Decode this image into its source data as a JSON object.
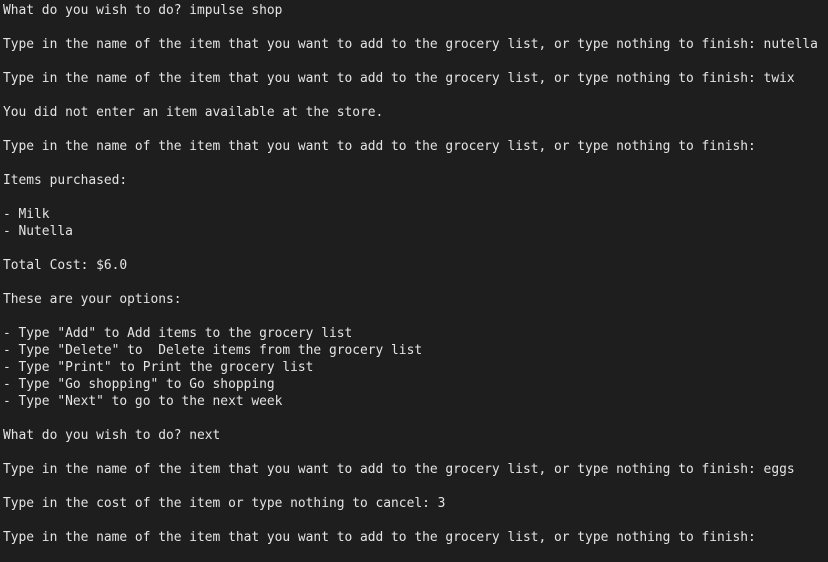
{
  "terminal": {
    "lines": [
      "What do you wish to do? impulse shop",
      "",
      "Type in the name of the item that you want to add to the grocery list, or type nothing to finish: nutella",
      "",
      "Type in the name of the item that you want to add to the grocery list, or type nothing to finish: twix",
      "",
      "You did not enter an item available at the store.",
      "",
      "Type in the name of the item that you want to add to the grocery list, or type nothing to finish:",
      "",
      "Items purchased:",
      "",
      "- Milk",
      "- Nutella",
      "",
      "Total Cost: $6.0",
      "",
      "These are your options:",
      "",
      "- Type \"Add\" to Add items to the grocery list",
      "- Type \"Delete\" to  Delete items from the grocery list",
      "- Type \"Print\" to Print the grocery list",
      "- Type \"Go shopping\" to Go shopping",
      "- Type \"Next\" to go to the next week",
      "",
      "What do you wish to do? next",
      "",
      "Type in the name of the item that you want to add to the grocery list, or type nothing to finish: eggs",
      "",
      "Type in the cost of the item or type nothing to cancel: 3",
      "",
      "Type in the name of the item that you want to add to the grocery list, or type nothing to finish:"
    ]
  }
}
